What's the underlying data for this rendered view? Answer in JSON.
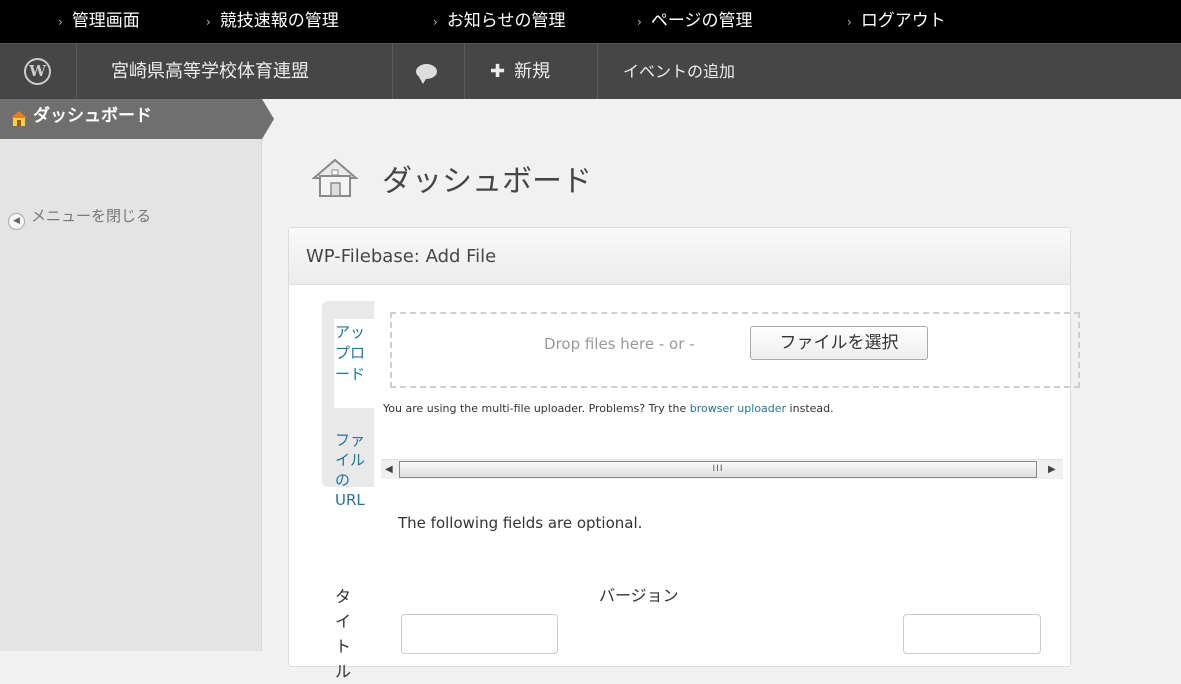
{
  "topnav": {
    "items": [
      "管理画面",
      "競技速報の管理",
      "お知らせの管理",
      "ページの管理",
      "ログアウト"
    ]
  },
  "adminbar": {
    "site_name": "宮崎県高等学校体育連盟",
    "new_label": "新規",
    "add_event": "イベントの追加"
  },
  "sidebar": {
    "active_label": "ダッシュボード",
    "collapse_label": "メニューを閉じる"
  },
  "page": {
    "title": "ダッシュボード"
  },
  "widget": {
    "title": "WP-Filebase: Add File",
    "tab_upload": "アップロード",
    "tab_url": "ファイルのURL",
    "drop_text": "Drop files here - or -",
    "select_button": "ファイルを選択",
    "multi_note_prefix": "You are using the multi-file uploader. Problems? Try the ",
    "multi_note_link": "browser uploader",
    "multi_note_suffix": " instead.",
    "scroll_thumb": "III",
    "optional_text": "The following fields are optional.",
    "title_label": "タイトル",
    "version_label": "バージョン"
  },
  "colors": {
    "topnav_bg": "#000000",
    "adminbar_bg": "#464646",
    "sidebar_active_bg": "#6f6f6f",
    "link": "#21759b"
  }
}
